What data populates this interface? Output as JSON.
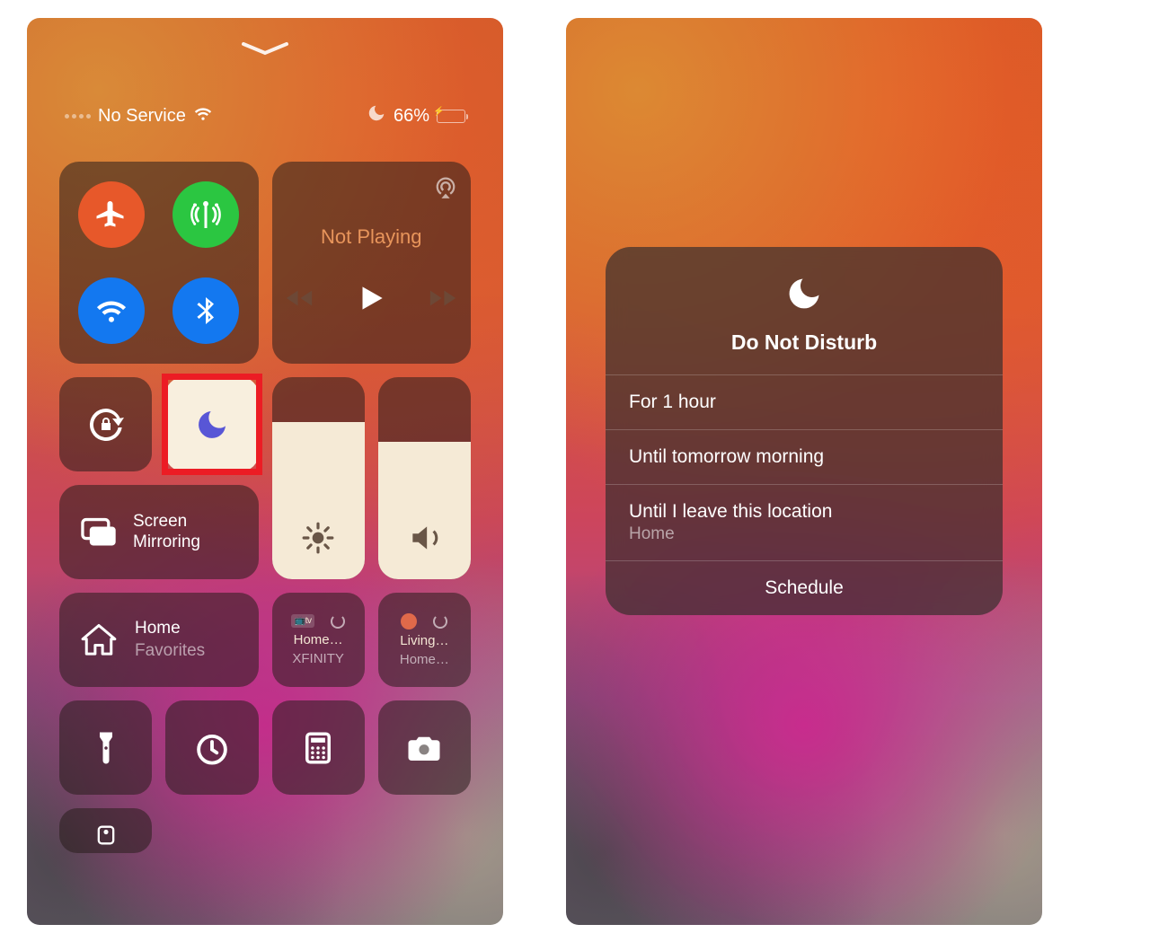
{
  "status": {
    "carrier": "No Service",
    "battery_pct": "66%"
  },
  "media": {
    "title": "Not Playing"
  },
  "mirror": {
    "l1": "Screen",
    "l2": "Mirroring"
  },
  "home": {
    "l1": "Home",
    "l2": "Favorites"
  },
  "acc1": {
    "badge": "📺tv",
    "l1": "Home…",
    "l2": "XFINITY"
  },
  "acc2": {
    "l1": "Living…",
    "l2": "Home…"
  },
  "dnd": {
    "title": "Do Not Disturb",
    "opt1": "For 1 hour",
    "opt2": "Until tomorrow morning",
    "opt3": "Until I leave this location",
    "opt3_sub": "Home",
    "opt4": "Schedule"
  }
}
